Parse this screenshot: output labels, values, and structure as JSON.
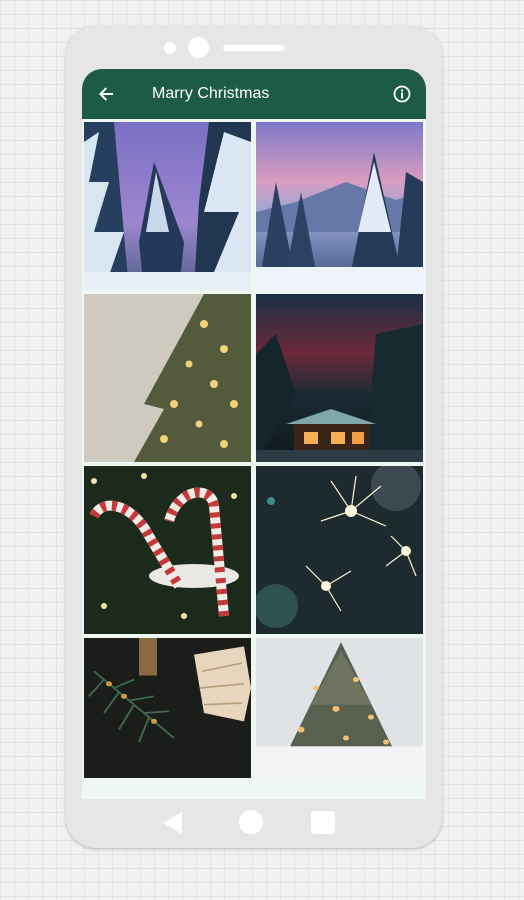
{
  "appbar": {
    "title": "Marry Christmas",
    "back_icon": "arrow-left-icon",
    "info_icon": "info-icon",
    "bg_color": "#1d5b45"
  },
  "wallpapers": [
    {
      "subject": "snowy-pine-forest-purple-sky"
    },
    {
      "subject": "snowy-fir-mountain-pink-sky"
    },
    {
      "subject": "blurred-christmas-tree-lights"
    },
    {
      "subject": "snowy-cabin-night"
    },
    {
      "subject": "candy-cane-heart-tree"
    },
    {
      "subject": "sparklers"
    },
    {
      "subject": "pine-branch-ornament"
    },
    {
      "subject": "snowy-tree-bokeh"
    }
  ],
  "navbar": {
    "back_icon": "triangle-back-icon",
    "home_icon": "circle-home-icon",
    "recents_icon": "square-recents-icon"
  }
}
